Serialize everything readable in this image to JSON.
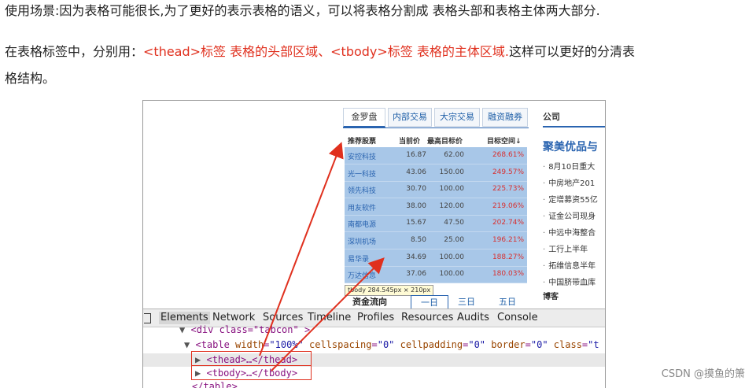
{
  "intro": {
    "line1": "使用场景:因为表格可能很长,为了更好的表示表格的语义，可以将表格分割成 表格头部和表格主体两大部分.",
    "line2_a": "在表格标签中，分别用：",
    "line2_b": "<thead>标签 表格的头部区域、<tbody>标签 表格的主体区域.",
    "line2_c": "这样可以更好的分清表",
    "line3": "格结构。"
  },
  "widget": {
    "tabs": [
      "金罗盘",
      "内部交易",
      "大宗交易",
      "融资融券"
    ],
    "headers": [
      "推荐股票",
      "当前价",
      "最高目标价",
      "目标空间↓"
    ],
    "rows": [
      [
        "安控科技",
        "16.87",
        "62.00",
        "268.61%"
      ],
      [
        "光一科技",
        "43.06",
        "150.00",
        "249.57%"
      ],
      [
        "领先科技",
        "30.70",
        "100.00",
        "225.73%"
      ],
      [
        "用友软件",
        "38.00",
        "120.00",
        "219.06%"
      ],
      [
        "南都电源",
        "15.67",
        "47.50",
        "202.74%"
      ],
      [
        "深圳机场",
        "8.50",
        "25.00",
        "196.21%"
      ],
      [
        "易华录",
        "34.69",
        "100.00",
        "188.27%"
      ],
      [
        "万达信息",
        "37.06",
        "100.00",
        "180.03%"
      ]
    ],
    "tooltip": "tbody 284.545px × 210px",
    "sub_tabs": [
      "资金流向",
      "一日",
      "三日",
      "五日"
    ]
  },
  "sidebar": {
    "heading": "公司",
    "title": "聚美优品与",
    "items": [
      "8月10日重大",
      "中房地产201",
      "定增募资55亿",
      "证金公司现身",
      "中远中海整合",
      "工行上半年",
      "拓维信息半年",
      "中国脐带血库"
    ],
    "blog": "博客"
  },
  "devtools": {
    "tabs": [
      "Elements",
      "Network",
      "Sources",
      "Timeline",
      "Profiles",
      "Resources",
      "Audits",
      "Console"
    ],
    "lines": {
      "div": "div class=\"tabcon\" >",
      "table_tag": "table",
      "table_attrs": [
        {
          "name": "width",
          "value": "\"100%\""
        },
        {
          "name": "cellspacing",
          "value": "\"0\""
        },
        {
          "name": "cellpadding",
          "value": "\"0\""
        },
        {
          "name": "border",
          "value": "\"0\""
        },
        {
          "name": "class",
          "value": "\"t"
        }
      ],
      "thead": "<thead>…</thead>",
      "tbody": "<tbody>…</tbody>",
      "close_table": "</table>"
    }
  },
  "watermark": "CSDN @摸鱼的箫",
  "colors": {
    "accent_red": "#e0301e",
    "tbody_highlight": "#a8c7e8",
    "link_blue": "#2a64b0"
  }
}
